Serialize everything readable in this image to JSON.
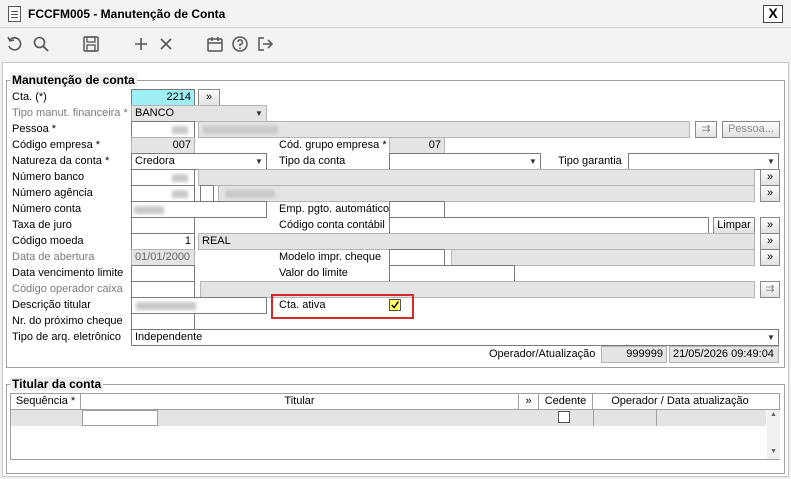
{
  "window": {
    "title": "FCCFM005 - Manutenção de Conta",
    "close_label": "X"
  },
  "toolbar": {
    "icons": [
      "undo-icon",
      "search-icon",
      "save-icon",
      "add-icon",
      "delete-icon",
      "calendar-icon",
      "help-icon",
      "exit-icon"
    ]
  },
  "section_main": {
    "title": "Manutenção de conta"
  },
  "fields": {
    "cta": {
      "label": "Cta. (*)",
      "value": "2214",
      "button": "»"
    },
    "tipo_manut": {
      "label": "Tipo manut. financeira *",
      "value": "BANCO"
    },
    "pessoa": {
      "label": "Pessoa *",
      "button": "Pessoa...",
      "search_button": "⇉"
    },
    "codigo_empresa": {
      "label": "Código empresa *",
      "value": "007"
    },
    "cod_grupo_empresa": {
      "label": "Cód. grupo empresa *",
      "value": "07"
    },
    "natureza_conta": {
      "label": "Natureza da conta *",
      "value": "Credora"
    },
    "tipo_conta": {
      "label": "Tipo da conta",
      "value": ""
    },
    "tipo_garantia": {
      "label": "Tipo garantia",
      "value": ""
    },
    "numero_banco": {
      "label": "Número banco"
    },
    "numero_agencia": {
      "label": "Número agência"
    },
    "numero_conta": {
      "label": "Número conta"
    },
    "emp_pgto": {
      "label": "Emp. pgto. automático",
      "value": ""
    },
    "taxa_juro": {
      "label": "Taxa de juro",
      "value": ""
    },
    "codigo_conta_contabil": {
      "label": "Código conta contábil",
      "value": "",
      "limpar": "Limpar"
    },
    "codigo_moeda": {
      "label": "Código moeda",
      "value": "1",
      "desc": "REAL"
    },
    "data_abertura": {
      "label": "Data de abertura",
      "value": "01/01/2000"
    },
    "modelo_impr": {
      "label": "Modelo impr. cheque",
      "value": ""
    },
    "data_venc": {
      "label": "Data vencimento limite",
      "value": ""
    },
    "valor_limite": {
      "label": "Valor do limite",
      "value": ""
    },
    "cod_operador_caixa": {
      "label": "Código operador caixa",
      "value": ""
    },
    "descricao_titular": {
      "label": "Descrição titular"
    },
    "cta_ativa": {
      "label": "Cta. ativa",
      "checked": true
    },
    "nr_proximo_cheque": {
      "label": "Nr. do próximo cheque",
      "value": ""
    },
    "tipo_arq": {
      "label": "Tipo de arq. eletrônico",
      "value": "Independente"
    },
    "operador": {
      "label": "Operador/Atualização",
      "code": "999999",
      "datetime": "21/05/2026 09:49:04"
    }
  },
  "more_button": "»",
  "section_titular": {
    "title": "Titular da conta",
    "columns": [
      "Sequência *",
      "Titular",
      "»",
      "Cedente",
      "Operador / Data atualização"
    ]
  }
}
